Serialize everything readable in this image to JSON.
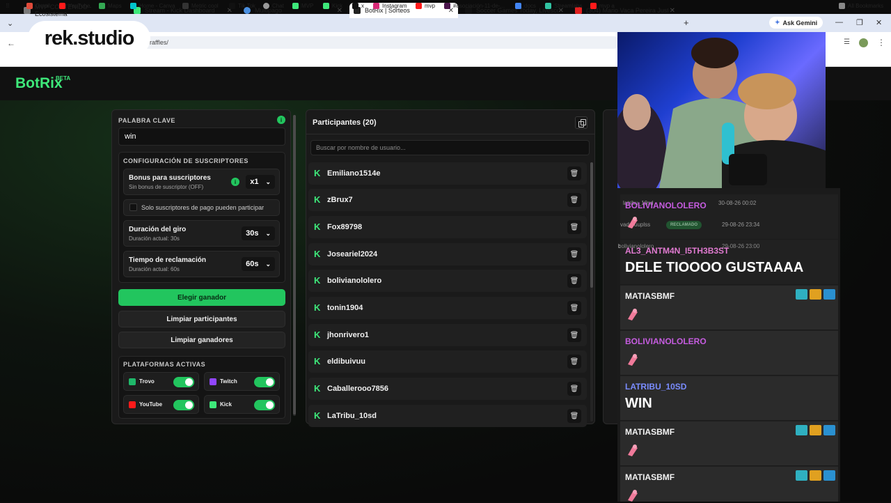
{
  "browser": {
    "tabs": [
      {
        "title": "MVP CONTENIDO - Ecosistema",
        "color": "#7a7a7a"
      },
      {
        "title": "Stream - Kick Dashboard",
        "color": "#3ee87a"
      },
      {
        "title": "Multipago",
        "color": "#4a8fe0"
      },
      {
        "title": "BotRix | Sorteos",
        "color": "#222222"
      },
      {
        "title": "Soccer Games Today, Livescore",
        "color": "#111111"
      },
      {
        "title": "(304) Mario Vaca Pereira Justin",
        "color": "#e02020"
      }
    ],
    "ask_gemini": "Ask Gemini",
    "url": "raffles/",
    "bookmarks": [
      "Gmail",
      "YouTube",
      "Maps",
      "Home - Canva",
      "Metric cool",
      "Tik Tok",
      "Chat",
      "MVP",
      "Kick",
      "x",
      "Instagram",
      "mvp",
      "#asociación-11-de-...",
      "docs",
      "Streamlabs",
      "mvp a"
    ],
    "all_bookmarks": "All Bookmarks"
  },
  "overlay": {
    "logo": "rek.studio"
  },
  "app": {
    "brand": "BotRix",
    "beta": "BETA"
  },
  "left": {
    "keyword_label": "PALABRA CLAVE",
    "keyword_value": "win",
    "subs_title": "CONFIGURACIÓN DE SUSCRIPTORES",
    "bonus_title": "Bonus para suscriptores",
    "bonus_sub": "Sin bonus de suscriptor (OFF)",
    "bonus_value": "x1",
    "only_paid": "Solo suscriptores de pago pueden participar",
    "spin_title": "Duración del giro",
    "spin_sub": "Duración actual: 30s",
    "spin_value": "30s",
    "claim_title": "Tiempo de reclamación",
    "claim_sub": "Duración actual: 60s",
    "claim_value": "60s",
    "pick_winner": "Elegir ganador",
    "clear_participants": "Limpiar participantes",
    "clear_winners": "Limpiar ganadores",
    "platforms_title": "PLATAFORMAS ACTIVAS",
    "platforms": [
      {
        "name": "Trovo",
        "color": "#1fb86a"
      },
      {
        "name": "Twitch",
        "color": "#9146ff"
      },
      {
        "name": "YouTube",
        "color": "#ff1a1a"
      },
      {
        "name": "Kick",
        "color": "#3ee87a"
      }
    ]
  },
  "participants": {
    "header": "Participantes (20)",
    "search_placeholder": "Buscar por nombre de usuario...",
    "list": [
      "Emiliano1514e",
      "zBrux7",
      "Fox89798",
      "Joseariel2024",
      "bolivianololero",
      "tonin1904",
      "jhonrivero1",
      "eldibuivuu",
      "Caballerooo7856",
      "LaTribu_10sd"
    ]
  },
  "winners_ghost": [
    {
      "user": "latribu_10sd",
      "date": "30-08-26 00:02"
    },
    {
      "user": "vaderuuplss",
      "status": "RECLAMADO",
      "date": "29-08-26 23:34"
    },
    {
      "user": "bolivianololero",
      "date": "29-08-26 23:00"
    }
  ],
  "chat": [
    {
      "user": "BOLIVIANOLOLERO",
      "color": "#c65ce0",
      "body": "",
      "badges": false
    },
    {
      "user": "AL3_ANTM4N_I5TH3B3ST",
      "color": "#e07ad0",
      "body": "DELE TIOOOO GUSTAAAA",
      "badges": false
    },
    {
      "user": "MATIASBMF",
      "color": "#f2f2f2",
      "body": "",
      "badges": true
    },
    {
      "user": "BOLIVIANOLOLERO",
      "color": "#c65ce0",
      "body": "",
      "badges": false
    },
    {
      "user": "LATRIBU_10SD",
      "color": "#7a8cff",
      "body": "WIN",
      "badges": false
    },
    {
      "user": "MATIASBMF",
      "color": "#f2f2f2",
      "body": "",
      "badges": true
    },
    {
      "user": "MATIASBMF",
      "color": "#f2f2f2",
      "body": "",
      "badges": true
    }
  ]
}
